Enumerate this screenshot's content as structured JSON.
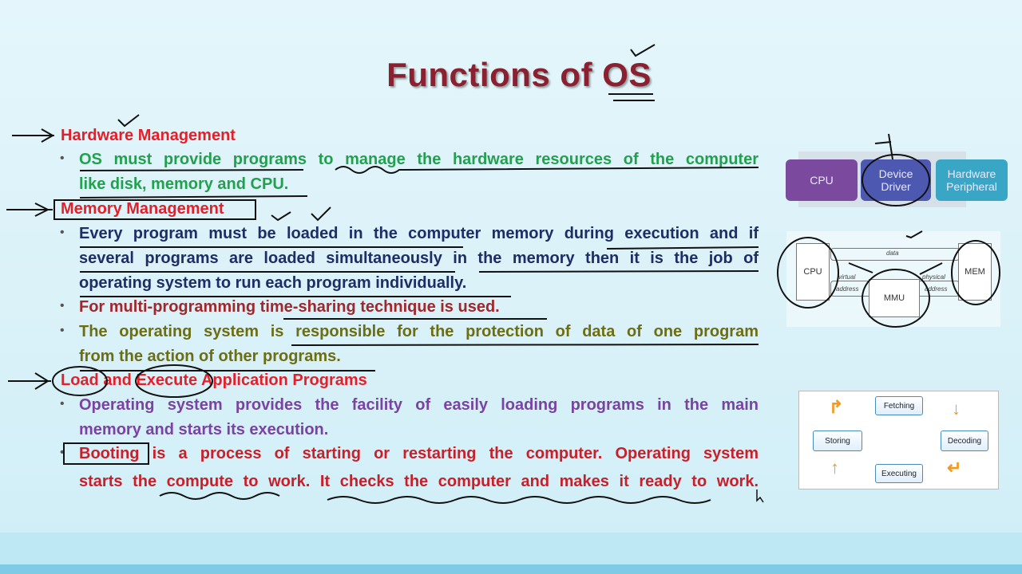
{
  "slide": {
    "title": "Functions of OS",
    "sections": [
      {
        "heading": "Hardware Management",
        "bullets": [
          [
            "OS must provide programs to manage the hardware resources of the computer",
            "like disk, memory and CPU."
          ]
        ]
      },
      {
        "heading": "Memory Management",
        "bullets": [
          [
            "Every program must be loaded in the computer memory during execution and if",
            "several programs are loaded simultaneously in the memory then it is the job of",
            "operating system to run each program individually."
          ],
          [
            "For multi-programming time-sharing technique is used."
          ],
          [
            "The operating system is responsible for the protection of data of one program",
            "from the action of other programs."
          ]
        ]
      },
      {
        "heading": "Load and Execute Application Programs",
        "bullets": [
          [
            "Operating system provides the facility of easily loading programs in the main",
            "memory and starts its execution."
          ],
          [
            "Booting is a process of starting or restarting the computer. Operating system",
            "starts the compute to work. It checks the computer and makes it ready to work."
          ]
        ]
      }
    ]
  },
  "diagram_driver": {
    "boxes": [
      "CPU",
      "Device Driver",
      "Hardware Peripheral"
    ],
    "colors": [
      "#7b4a9e",
      "#4d58b0",
      "#3aa6c6"
    ]
  },
  "diagram_mmu": {
    "cpu": "CPU",
    "mmu": "MMU",
    "mem": "MEM",
    "data": "data",
    "virtual": "virtual",
    "physical": "physical",
    "address1": "address",
    "address2": "address"
  },
  "diagram_cycle": {
    "steps": [
      "Fetching",
      "Decoding",
      "Executing",
      "Storing"
    ]
  },
  "colors": {
    "title": "#8a2030",
    "heading": "#e3202a"
  }
}
